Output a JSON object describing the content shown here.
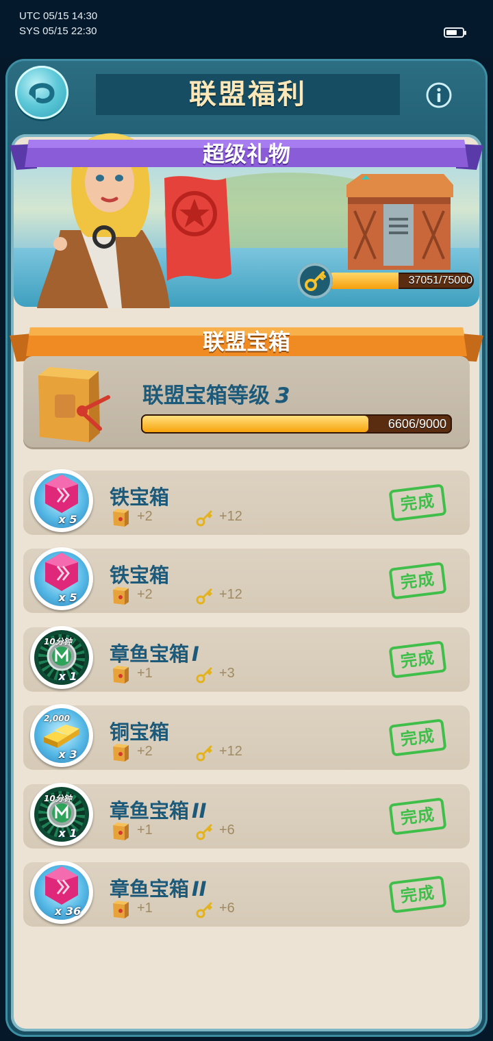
{
  "status_bar": {
    "utc": "UTC 05/15 14:30",
    "sys": "SYS 05/15 22:30",
    "battery_level": 0.7
  },
  "header": {
    "title": "联盟福利",
    "back_icon": "back-arrow-icon",
    "info_icon": "info-icon"
  },
  "super_gift": {
    "title": "超级礼物",
    "keys_current": 37051,
    "keys_total": 75000,
    "keys_text": "37051/75000",
    "key_icon": "key-icon"
  },
  "alliance_chest": {
    "title": "联盟宝箱",
    "level_label": "联盟宝箱等级",
    "level_value": "3",
    "progress_current": 6606,
    "progress_total": 9000,
    "progress_text": "6606/9000"
  },
  "tasks": [
    {
      "name": "铁宝箱",
      "roman": "",
      "icon": "gem-icon",
      "qty": "x 5",
      "badge": "",
      "chest_reward": "+2",
      "key_reward": "+12",
      "status": "完成"
    },
    {
      "name": "铁宝箱",
      "roman": "",
      "icon": "gem-icon",
      "qty": "x 5",
      "badge": "",
      "chest_reward": "+2",
      "key_reward": "+12",
      "status": "完成"
    },
    {
      "name": "章鱼宝箱",
      "roman": "I",
      "icon": "speedup-icon",
      "qty": "x 1",
      "badge": "10分钟",
      "chest_reward": "+1",
      "key_reward": "+3",
      "status": "完成"
    },
    {
      "name": "铜宝箱",
      "roman": "",
      "icon": "gold-bars-icon",
      "qty": "x 3",
      "badge": "2,000",
      "chest_reward": "+2",
      "key_reward": "+12",
      "status": "完成"
    },
    {
      "name": "章鱼宝箱",
      "roman": "II",
      "icon": "speedup-icon",
      "qty": "x 1",
      "badge": "10分钟",
      "chest_reward": "+1",
      "key_reward": "+6",
      "status": "完成"
    },
    {
      "name": "章鱼宝箱",
      "roman": "II",
      "icon": "gem-icon",
      "qty": "x 36",
      "badge": "",
      "chest_reward": "+1",
      "key_reward": "+6",
      "status": "完成"
    }
  ]
}
